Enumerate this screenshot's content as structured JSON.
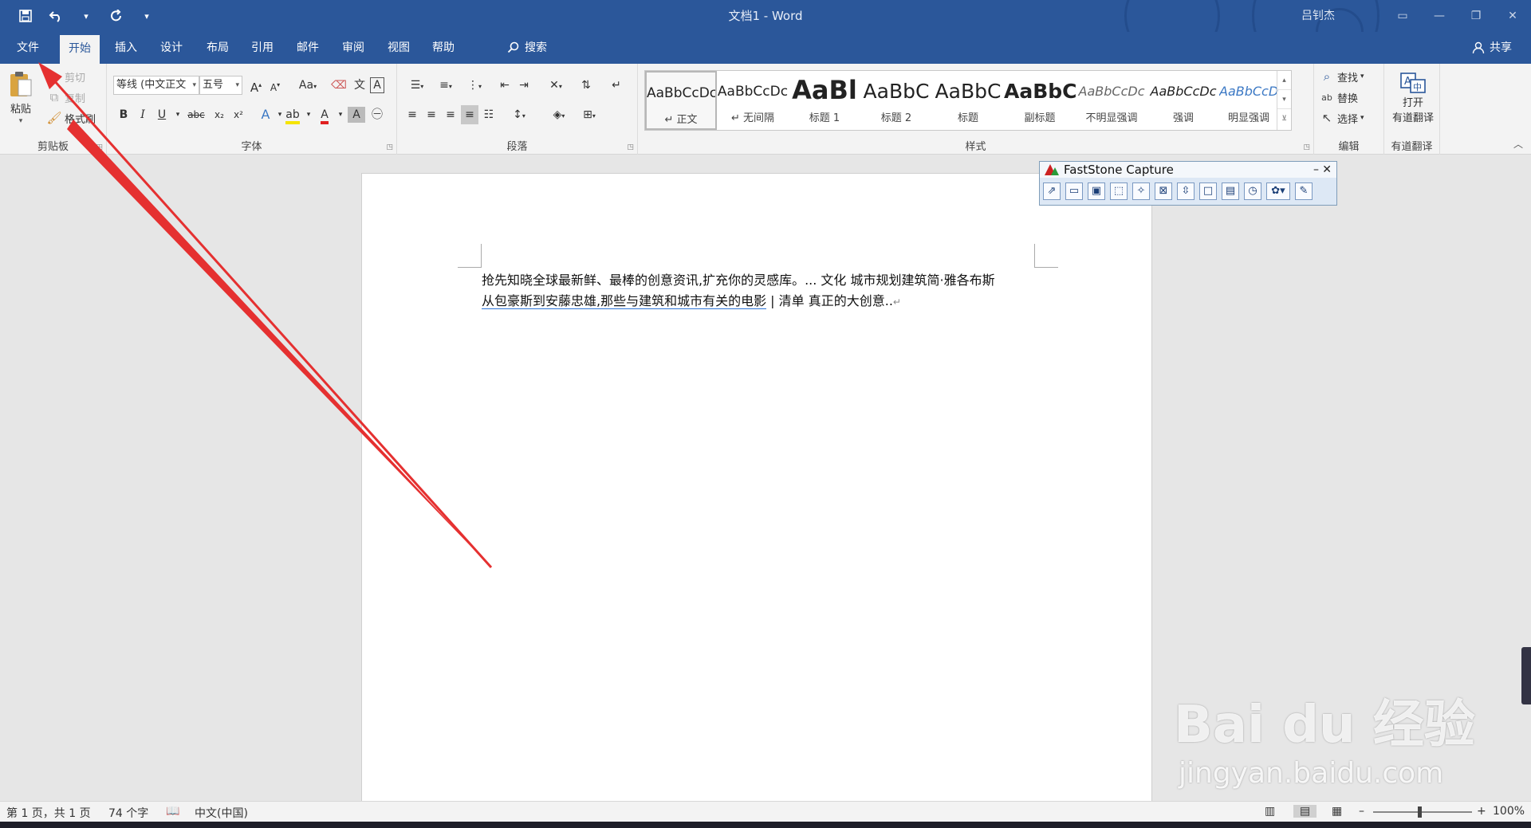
{
  "window": {
    "title": "文档1 - Word",
    "user": "吕钊杰"
  },
  "qat": {
    "save_icon": "save-icon",
    "undo_icon": "undo-icon",
    "redo_icon": "redo-icon",
    "customize_icon": "chevron-down-icon"
  },
  "tabs": [
    "文件",
    "开始",
    "插入",
    "设计",
    "布局",
    "引用",
    "邮件",
    "审阅",
    "视图",
    "帮助"
  ],
  "active_tab": "开始",
  "search_label": "搜索",
  "share_label": "共享",
  "ribbon": {
    "clipboard": {
      "label": "剪贴板",
      "paste": "粘贴",
      "cut": "剪切",
      "copy": "复制",
      "format_painter": "格式刷"
    },
    "font": {
      "label": "字体",
      "font_name": "等线 (中文正文",
      "font_size": "五号",
      "grow": "A",
      "shrink": "A",
      "case": "Aa",
      "bold": "B",
      "italic": "I",
      "underline": "U",
      "strike": "abc",
      "subscript": "x₂",
      "superscript": "x²"
    },
    "paragraph": {
      "label": "段落"
    },
    "styles": {
      "label": "样式",
      "items": [
        {
          "preview": "AaBbCcDc",
          "name": "正文"
        },
        {
          "preview": "AaBbCcDc",
          "name": "无间隔"
        },
        {
          "preview": "AaBl",
          "name": "标题 1"
        },
        {
          "preview": "AaBbC",
          "name": "标题 2"
        },
        {
          "preview": "AaBbC",
          "name": "标题"
        },
        {
          "preview": "AaBbC",
          "name": "副标题"
        },
        {
          "preview": "AaBbCcDc",
          "name": "不明显强调"
        },
        {
          "preview": "AaBbCcDc",
          "name": "强调"
        },
        {
          "preview": "AaBbCcDc",
          "name": "明显强调"
        }
      ]
    },
    "editing": {
      "label": "编辑",
      "find": "查找",
      "replace": "替换",
      "select": "选择"
    },
    "youdao": {
      "label": "有道翻译",
      "open_line1": "打开",
      "open_line2": "有道翻译"
    }
  },
  "document": {
    "line1": "抢先知晓全球最新鲜、最棒的创意资讯,扩充你的灵感库。... 文化  城市规划建筑简·雅各布斯",
    "line2_link": "从包豪斯到安藤忠雄,那些与建筑和城市有关的电影",
    "line2_rest": " | 清单  真正的大创意..",
    "para_mark": "↵"
  },
  "faststone": {
    "title": "FastStone Capture",
    "minimize": "–",
    "close": "✕"
  },
  "status": {
    "page": "第 1 页，共 1 页",
    "words": "74 个字",
    "language": "中文(中国)",
    "zoom_minus": "–",
    "zoom_plus": "+",
    "zoom": "100%"
  },
  "watermark": {
    "brand": "Bai du 经验",
    "url": "jingyan.baidu.com"
  },
  "colors": {
    "brand": "#2b579a",
    "arrow": "#e53030"
  }
}
